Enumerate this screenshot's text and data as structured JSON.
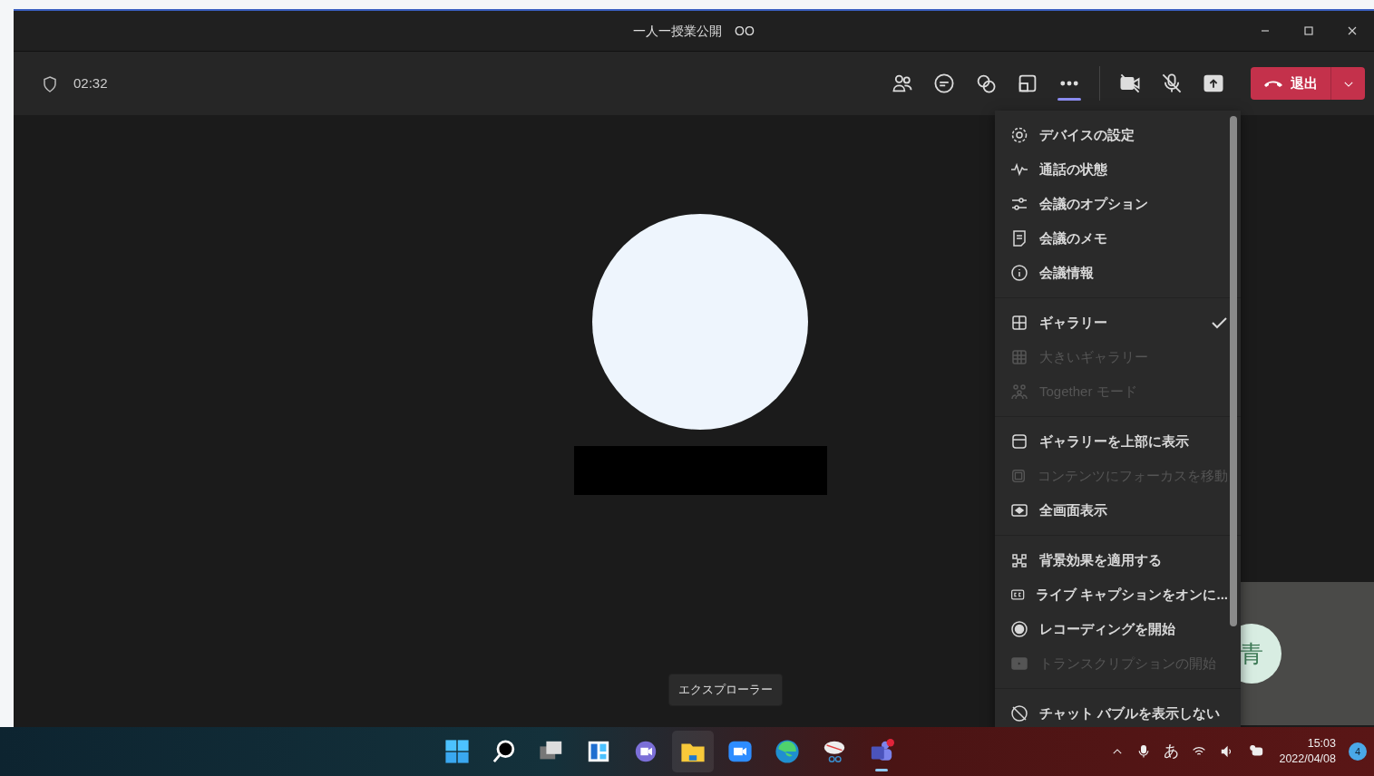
{
  "window": {
    "title": "一人一授業公開　OO"
  },
  "toolbar": {
    "timer": "02:32",
    "tools": [
      {
        "kind": "people",
        "selected": false
      },
      {
        "kind": "chat",
        "selected": false
      },
      {
        "kind": "react",
        "selected": false
      },
      {
        "kind": "rooms",
        "selected": false
      },
      {
        "kind": "more",
        "selected": true
      },
      {
        "kind": "camera-off",
        "selected": false
      },
      {
        "kind": "mic-off",
        "selected": false
      },
      {
        "kind": "share",
        "selected": false
      }
    ],
    "leave_button": "退出"
  },
  "menu": {
    "groups": [
      [
        {
          "kind": "gear",
          "label": "デバイスの設定",
          "disabled": false,
          "checked": false
        },
        {
          "kind": "pulse",
          "label": "通話の状態",
          "disabled": false,
          "checked": false
        },
        {
          "kind": "sliders",
          "label": "会議のオプション",
          "disabled": false,
          "checked": false
        },
        {
          "kind": "note",
          "label": "会議のメモ",
          "disabled": false,
          "checked": false
        },
        {
          "kind": "info",
          "label": "会議情報",
          "disabled": false,
          "checked": false
        }
      ],
      [
        {
          "kind": "grid",
          "label": "ギャラリー",
          "disabled": false,
          "checked": true
        },
        {
          "kind": "grid9",
          "label": "大きいギャラリー",
          "disabled": true,
          "checked": false
        },
        {
          "kind": "people",
          "label": "Together モード",
          "disabled": true,
          "checked": false
        }
      ],
      [
        {
          "kind": "panel",
          "label": "ギャラリーを上部に表示",
          "disabled": false,
          "checked": false
        },
        {
          "kind": "focus",
          "label": "コンテンツにフォーカスを移動",
          "disabled": true,
          "checked": false
        },
        {
          "kind": "full",
          "label": "全画面表示",
          "disabled": false,
          "checked": false
        }
      ],
      [
        {
          "kind": "effects",
          "label": "背景効果を適用する",
          "disabled": false,
          "checked": false
        },
        {
          "kind": "cc",
          "label": "ライブ キャプションをオンに...",
          "disabled": false,
          "checked": false
        },
        {
          "kind": "record",
          "label": "レコーディングを開始",
          "disabled": false,
          "checked": false
        },
        {
          "kind": "transcript",
          "label": "トランスクリプションの開始",
          "disabled": true,
          "checked": false
        }
      ],
      [
        {
          "kind": "chatoff",
          "label": "チャット バブルを表示しない",
          "disabled": false,
          "checked": false
        }
      ]
    ]
  },
  "stage": {
    "participant_initial": "青"
  },
  "tooltip": "エクスプローラー",
  "taskbar": {
    "apps": [
      {
        "kind": "start",
        "active": false,
        "running": false
      },
      {
        "kind": "search",
        "active": false,
        "running": false
      },
      {
        "kind": "taskview",
        "active": false,
        "running": false
      },
      {
        "kind": "widgets",
        "active": false,
        "running": false
      },
      {
        "kind": "chat",
        "active": false,
        "running": false
      },
      {
        "kind": "folder",
        "active": true,
        "running": false
      },
      {
        "kind": "video",
        "active": false,
        "running": false
      },
      {
        "kind": "browser",
        "active": false,
        "running": false
      },
      {
        "kind": "snip",
        "active": false,
        "running": false
      },
      {
        "kind": "teams",
        "active": false,
        "running": true
      }
    ],
    "ime": "あ",
    "time": "15:03",
    "date": "2022/04/08",
    "notifications": "4"
  }
}
